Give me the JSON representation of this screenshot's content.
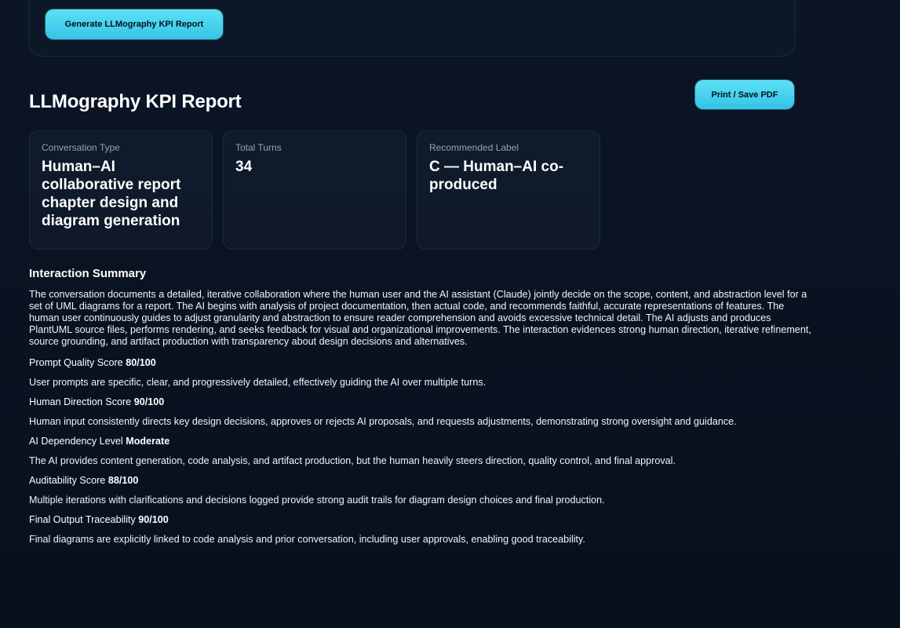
{
  "generate_button": "Generate LLMography KPI Report",
  "print_button": "Print / Save PDF",
  "report_title": "LLMography KPI Report",
  "cards": [
    {
      "label": "Conversation Type",
      "value": "Human–AI collaborative report chapter design and diagram generation"
    },
    {
      "label": "Total Turns",
      "value": "34"
    },
    {
      "label": "Recommended Label",
      "value": "C — Human–AI co-produced"
    }
  ],
  "summary": {
    "title": "Interaction Summary",
    "text": "The conversation documents a detailed, iterative collaboration where the human user and the AI assistant (Claude) jointly decide on the scope, content, and abstraction level for a set of UML diagrams for a report. The AI begins with analysis of project documentation, then actual code, and recommends faithful, accurate representations of features. The human user continuously guides to adjust granularity and abstraction to ensure reader comprehension and avoids excessive technical detail. The AI adjusts and produces PlantUML source files, performs rendering, and seeks feedback for visual and organizational improvements. The interaction evidences strong human direction, iterative refinement, source grounding, and artifact production with transparency about design decisions and alternatives."
  },
  "metrics": [
    {
      "label": "Prompt Quality Score",
      "value": "80/100",
      "desc": "User prompts are specific, clear, and progressively detailed, effectively guiding the AI over multiple turns."
    },
    {
      "label": "Human Direction Score",
      "value": "90/100",
      "desc": "Human input consistently directs key design decisions, approves or rejects AI proposals, and requests adjustments, demonstrating strong oversight and guidance."
    },
    {
      "label": "AI Dependency Level",
      "value": "Moderate",
      "desc": "The AI provides content generation, code analysis, and artifact production, but the human heavily steers direction, quality control, and final approval."
    },
    {
      "label": "Auditability Score",
      "value": "88/100",
      "desc": "Multiple iterations with clarifications and decisions logged provide strong audit trails for diagram design choices and final production."
    },
    {
      "label": "Final Output Traceability",
      "value": "90/100",
      "desc": "Final diagrams are explicitly linked to code analysis and prior conversation, including user approvals, enabling good traceability."
    }
  ]
}
